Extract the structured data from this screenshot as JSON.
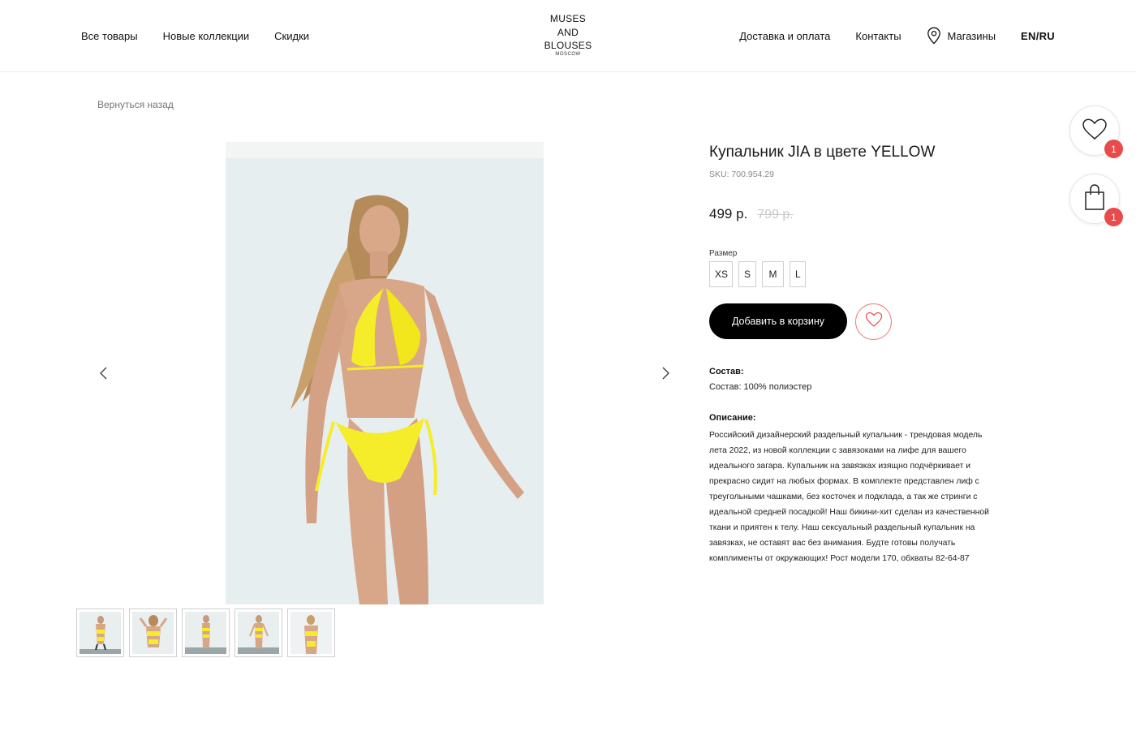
{
  "header": {
    "nav_left": [
      "Все товары",
      "Новые коллекции",
      "Скидки"
    ],
    "logo": {
      "line1": "MUSES",
      "line2": "AND",
      "line3": "BLOUSES",
      "sub": "MOSCOW"
    },
    "nav_right": {
      "delivery": "Доставка и оплата",
      "contacts": "Контакты",
      "stores": "Магазины",
      "lang": "EN/RU"
    }
  },
  "back_link": "Вернуться назад",
  "product": {
    "title": "Купальник JIA в цвете YELLOW",
    "sku": "SKU: 700.954.29",
    "price": "499 р.",
    "old_price": "799 р.",
    "size_label": "Размер",
    "sizes": [
      "XS",
      "S",
      "M",
      "L"
    ],
    "add_to_cart": "Добавить в корзину",
    "composition_heading": "Состав:",
    "composition_text": "Состав: 100% полиэстер",
    "description_heading": "Описание:",
    "description_text": "Российский дизайнерский раздельный купальник - трендовая модель лета 2022, из новой коллекции с завязоками на лифе для вашего идеального загара. Купальник на завязках изящно подчёркивает и прекрасно сидит на любых формах. В комплекте представлен лиф с треугольными чашками, без косточек и подклада, а так же стринги с идеальной средней посадкой! Наш бикини-хит сделан из качественной ткани и приятен к телу. Наш сексуальный раздельный купальник на завязках, не оставят вас без внимания. Будте готовы получать комплименты от окружающих! Рост модели 170, обхваты 82-64-87"
  },
  "floating": {
    "favorites_count": "1",
    "cart_count": "1"
  },
  "colors": {
    "accent_red": "#e94a4a",
    "swimsuit_yellow": "#f5ec2a",
    "photo_bg": "#e7eeef"
  },
  "icons": [
    "pin-icon",
    "heart-icon",
    "bag-icon",
    "chevron-left-icon",
    "chevron-right-icon"
  ]
}
